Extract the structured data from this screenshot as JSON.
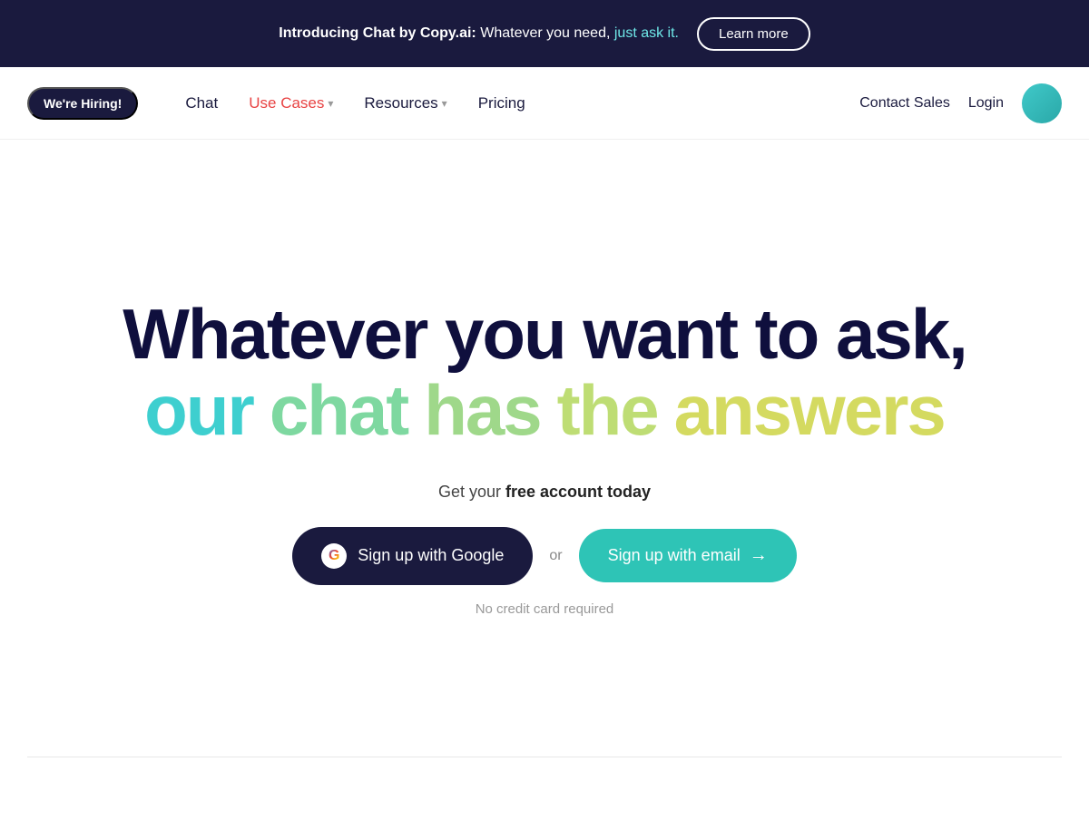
{
  "banner": {
    "text_intro": "Introducing Chat by Copy.ai:",
    "text_main": " Whatever you need, ",
    "text_highlight": "just ask it.",
    "learn_more_label": "Learn more"
  },
  "navbar": {
    "hiring_label": "We're Hiring!",
    "links": [
      {
        "id": "chat",
        "label": "Chat",
        "has_dropdown": false,
        "color": "normal"
      },
      {
        "id": "use-cases",
        "label": "Use Cases",
        "has_dropdown": true,
        "color": "red"
      },
      {
        "id": "resources",
        "label": "Resources",
        "has_dropdown": true,
        "color": "normal"
      },
      {
        "id": "pricing",
        "label": "Pricing",
        "has_dropdown": false,
        "color": "normal"
      }
    ],
    "contact_sales_label": "Contact Sales",
    "login_label": "Login"
  },
  "hero": {
    "title_line1": "Whatever you want to ask,",
    "title_line2_words": [
      "our",
      "chat",
      "has",
      "the",
      "answers"
    ],
    "subtitle_prefix": "Get your ",
    "subtitle_bold": "free account today",
    "btn_google_label": "Sign up with Google",
    "or_label": "or",
    "btn_email_label": "Sign up with email",
    "no_cc_label": "No credit card required"
  }
}
